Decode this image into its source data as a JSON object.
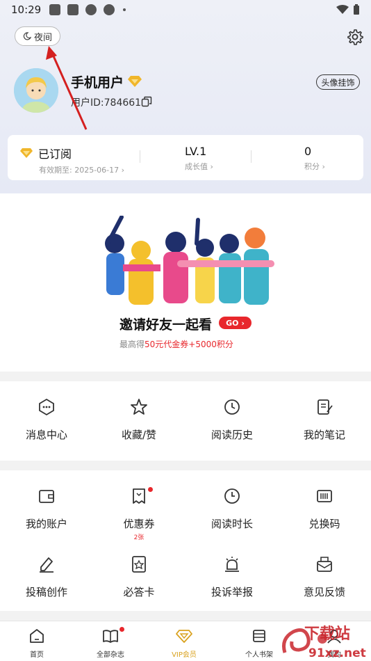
{
  "status_bar": {
    "time": "10:29"
  },
  "header": {
    "night_label": "夜间"
  },
  "profile": {
    "name": "手机用户",
    "user_id": "用户ID:784661",
    "frame_button": "头像挂饰"
  },
  "stats": {
    "subscribed_label": "已订阅",
    "subscribed_sub": "有效期至: 2025-06-17 ›",
    "level_value": "LV.1",
    "level_sub": "成长值 ›",
    "points_value": "0",
    "points_sub": "积分 ›"
  },
  "invite": {
    "title": "邀请好友一起看",
    "go_label": "GO ›",
    "sub_prefix": "最高得",
    "sub_highlight": "50元代金券+5000积分"
  },
  "menu_row1": [
    {
      "label": "消息中心",
      "icon": "message-icon"
    },
    {
      "label": "收藏/赞",
      "icon": "star-icon"
    },
    {
      "label": "阅读历史",
      "icon": "history-icon"
    },
    {
      "label": "我的笔记",
      "icon": "note-icon"
    }
  ],
  "menu_row2": [
    {
      "label": "我的账户",
      "icon": "wallet-icon"
    },
    {
      "label": "优惠券",
      "icon": "coupon-icon",
      "sub": "2张"
    },
    {
      "label": "阅读时长",
      "icon": "clock-icon"
    },
    {
      "label": "兑换码",
      "icon": "barcode-icon"
    }
  ],
  "menu_row3": [
    {
      "label": "投稿创作",
      "icon": "pen-icon"
    },
    {
      "label": "必答卡",
      "icon": "card-icon"
    },
    {
      "label": "投诉举报",
      "icon": "alarm-icon"
    },
    {
      "label": "意见反馈",
      "icon": "feedback-icon"
    }
  ],
  "tabbar": [
    {
      "label": "首页",
      "icon": "home-icon"
    },
    {
      "label": "全部杂志",
      "icon": "book-icon"
    },
    {
      "label": "VIP会员",
      "icon": "diamond-icon"
    },
    {
      "label": "个人书架",
      "icon": "shelf-icon"
    },
    {
      "label": "我的",
      "icon": "user-icon"
    }
  ],
  "watermark": {
    "line1": "下载站",
    "line2": "91xz.net"
  },
  "colors": {
    "accent_red": "#e8272c",
    "vip_gold": "#d9a21f",
    "annotation_arrow": "#d42020"
  }
}
